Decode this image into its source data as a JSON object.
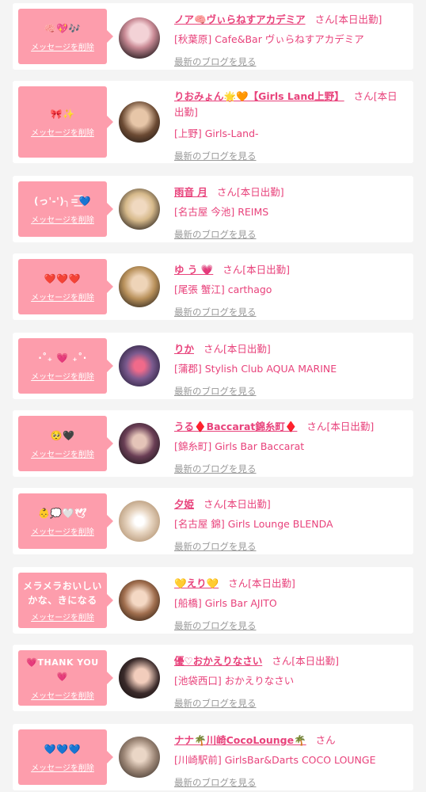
{
  "delete_label": "メッセージを削除",
  "san_label": "さん",
  "blog_label": "最新のブログを見る",
  "colors": {
    "bubble": "#fd9dac",
    "accent": "#e8427b",
    "muted": "#999999"
  },
  "cards": [
    {
      "message": "🧠💖🎶",
      "name": "ノア🧠ヴぃらねすアカデミア",
      "status": "[本日出勤]",
      "shop": "[秋葉原] Cafe&Bar ヴぃらねすアカデミア"
    },
    {
      "message": "🎀✨",
      "name": "りおみょん🌟🧡【Girls Land上野】",
      "status": "[本日出勤]",
      "shop": "[上野] Girls-Land-"
    },
    {
      "message": "(っ'-')╮=͟͟͞͞💙",
      "name": "雨音 月",
      "status": "[本日出勤]",
      "shop": "[名古屋 今池] REIMS"
    },
    {
      "message": "❤️❤️❤️",
      "name": "ゆ う 💗",
      "status": "[本日出勤]",
      "shop": "[尾張 蟹江] carthago"
    },
    {
      "message": "·˚₊ 💗 ₊˚·",
      "name": "りか",
      "status": "[本日出勤]",
      "shop": "[蒲郡] Stylish Club AQUA MARINE"
    },
    {
      "message": "🥺🖤",
      "name": "うる♦️Baccarat錦糸町♦️",
      "status": "[本日出勤]",
      "shop": "[錦糸町] Girls Bar Baccarat"
    },
    {
      "message": "👶💭🤍🕊",
      "name": "夕姫",
      "status": "[本日出勤]",
      "shop": "[名古屋 錦] Girls Lounge BLENDA"
    },
    {
      "message": "メラメラおいしいかな、きになる",
      "name": "💛えり💛",
      "status": "[本日出勤]",
      "shop": "[船橋] Girls Bar AJITO"
    },
    {
      "message": "💗THANK YOU💗",
      "name": "優♡おかえりなさい",
      "status": "[本日出勤]",
      "shop": "[池袋西口] おかえりなさい"
    },
    {
      "message": "💙💙💙",
      "name": "ナナ🌴川崎CocoLounge🌴",
      "status": "",
      "shop": "[川崎駅前] GirlsBar&Darts COCO LOUNGE"
    }
  ]
}
